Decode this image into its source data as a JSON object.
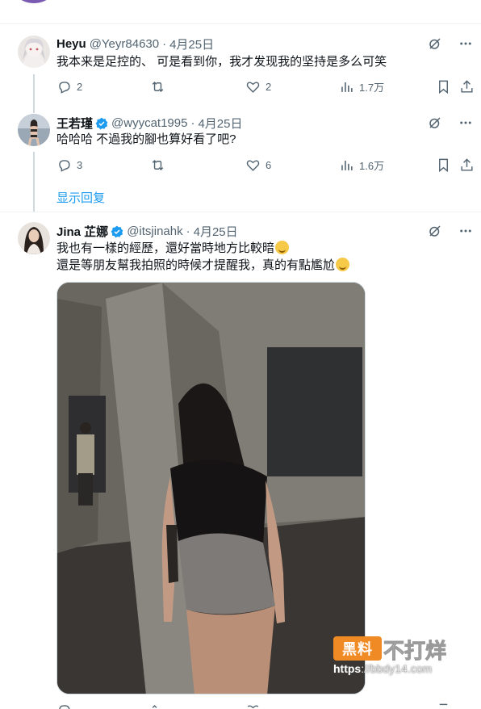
{
  "tweets": [
    {
      "name": "Heyu",
      "handle": "@Yeyr84630",
      "time": "4月25日",
      "text": "我本来是足控的、 可是看到你，我才发现我的坚持是多么可笑",
      "replies": "2",
      "retweets": "",
      "likes": "2",
      "views": "1.7万",
      "verified": false
    },
    {
      "name": "王若瑾",
      "handle": "@wyycat1995",
      "time": "4月25日",
      "text": "哈哈哈 不過我的腳也算好看了吧?",
      "replies": "3",
      "retweets": "",
      "likes": "6",
      "views": "1.6万",
      "verified": true
    },
    {
      "name": "Jina 芷娜",
      "handle": "@itsjinahk",
      "time": "4月25日",
      "text_line1": "我也有一樣的經歷，還好當時地方比較暗",
      "text_line2": "還是等朋友幫我拍照的時候才提醒我，真的有點尷尬",
      "verified": true
    }
  ],
  "show_replies": "显示回复",
  "separator": "·",
  "watermark": {
    "box": "黑料",
    "text": "不打烊",
    "url_prefix": "https",
    "url_rest": "://bbdy14.com"
  },
  "colors": {
    "accent": "#1d9bf0",
    "muted": "#536471",
    "border": "#eff3f4"
  },
  "icons": [
    "reply-icon",
    "retweet-icon",
    "like-icon",
    "views-icon",
    "bookmark-icon",
    "share-icon",
    "grok-icon",
    "more-icon",
    "verified-icon"
  ]
}
